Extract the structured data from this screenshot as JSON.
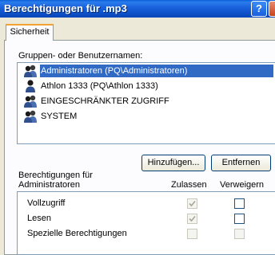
{
  "window": {
    "title": "Berechtigungen für .mp3",
    "help_label": "?"
  },
  "tabs": [
    {
      "label": "Sicherheit"
    }
  ],
  "groups": {
    "label": "Gruppen- oder Benutzernamen:",
    "items": [
      {
        "label": "Administratoren (PQ\\Administratoren)",
        "selected": true
      },
      {
        "label": "Athlon 1333 (PQ\\Athlon 1333)",
        "selected": false
      },
      {
        "label": "EINGESCHRÄNKTER ZUGRIFF",
        "selected": false
      },
      {
        "label": "SYSTEM",
        "selected": false
      }
    ]
  },
  "buttons": {
    "add": "Hinzufügen...",
    "remove": "Entfernen"
  },
  "permissions": {
    "header_line1": "Berechtigungen für",
    "header_line2": "Administratoren",
    "col_allow": "Zulassen",
    "col_deny": "Verweigern",
    "rows": [
      {
        "name": "Vollzugriff",
        "allow": true,
        "allow_disabled": true,
        "deny": false,
        "deny_disabled": false
      },
      {
        "name": "Lesen",
        "allow": true,
        "allow_disabled": true,
        "deny": false,
        "deny_disabled": false
      },
      {
        "name": "Spezielle Berechtigungen",
        "allow": false,
        "allow_disabled": true,
        "deny": false,
        "deny_disabled": true
      }
    ]
  },
  "colors": {
    "titlebar": "#0a5fd9",
    "selection": "#316ac5",
    "dialog_bg": "#ece9d8"
  }
}
